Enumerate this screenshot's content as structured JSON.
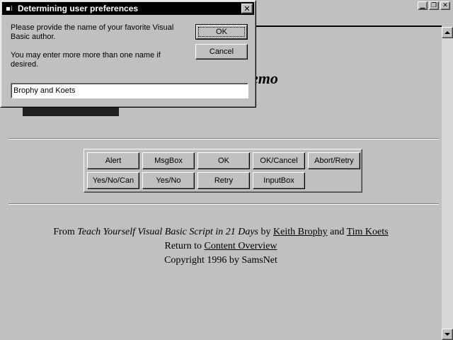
{
  "browser": {
    "window_buttons": [
      {
        "name": "minimize",
        "glyph": "▁"
      },
      {
        "name": "restore",
        "glyph": "❐"
      },
      {
        "name": "close",
        "glyph": "✕"
      }
    ]
  },
  "page": {
    "title_partial": "emo",
    "demo_buttons": [
      [
        "Alert",
        "MsgBox",
        "OK",
        "OK/Cancel",
        "Abort/Retry"
      ],
      [
        "Yes/No/Can",
        "Yes/No",
        "Retry",
        "InputBox"
      ]
    ],
    "footer": {
      "from_prefix": "From ",
      "book_title": "Teach Yourself Visual Basic Script in 21 Days",
      "by": " by ",
      "author1": "Keith Brophy",
      "and": " and ",
      "author2": "Tim Koets",
      "return_prefix": "Return to ",
      "return_link": "Content Overview",
      "copyright": "Copyright 1996 by SamsNet"
    }
  },
  "dialog": {
    "title": "Determining user preferences",
    "icon": "vb-app-icon",
    "close_glyph": "✕",
    "prompt_line1": "Please provide the name of your favorite Visual Basic author.",
    "prompt_line2": "You may enter more more than one name if desired.",
    "ok_label": "OK",
    "cancel_label": "Cancel",
    "input_value": "Brophy and Koets"
  }
}
